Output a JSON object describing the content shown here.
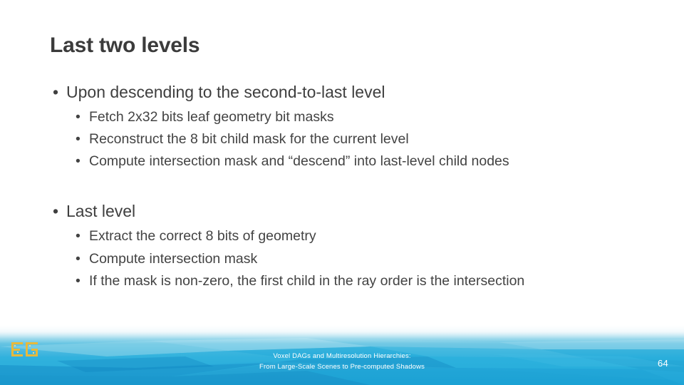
{
  "slide": {
    "title": "Last two levels",
    "page_number": "64",
    "blocks": [
      {
        "heading": "Upon descending to the second-to-last level",
        "items": [
          "Fetch 2x32 bits leaf geometry bit masks",
          "Reconstruct the 8 bit child mask for the current level",
          "Compute intersection mask and “descend” into last-level child nodes"
        ]
      },
      {
        "heading": "Last level",
        "items": [
          "Extract the correct 8 bits of geometry",
          "Compute intersection mask",
          "If the mask is non-zero, the first child in the ray order is the intersection"
        ]
      }
    ],
    "bullet_glyph": "•",
    "footer": {
      "line1": "Voxel DAGs and Multiresolution Hierarchies:",
      "line2": "From Large-Scale Scenes to Pre-computed Shadows",
      "logo_text": "EG"
    },
    "colors": {
      "title": "#3b3b3b",
      "body_text": "#3f3f3f",
      "sub_text": "#434343",
      "footer_blue": "#29aade",
      "footer_text": "#ffffff",
      "logo_gold": "#e8b93b",
      "background": "#ffffff"
    }
  }
}
